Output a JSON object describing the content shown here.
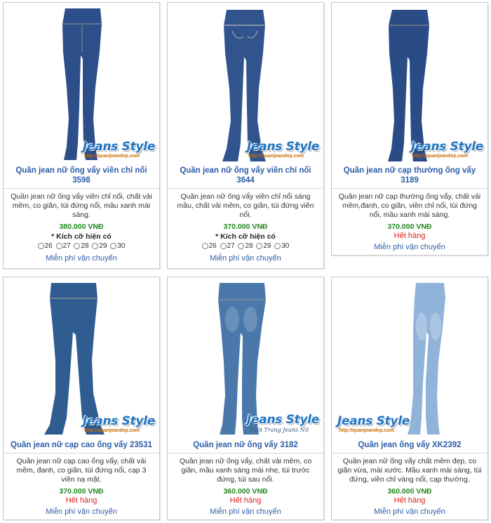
{
  "products": [
    {
      "title": "Quần jean nữ ống vẩy viền chỉ nổi 3598",
      "description": "Quần jean nữ ống vẩy viền chỉ nổi, chất vải mềm, co giãn, túi đứng nổi, mầu xanh mài sáng.",
      "price": "380.000 VNĐ",
      "status": "",
      "sizes_title": "* Kích cỡ hiện có",
      "sizes": [
        "26",
        "27",
        "28",
        "29",
        "30"
      ],
      "shipping": "Miễn phí vận chuyển",
      "jeans_color": "#2c4f8a",
      "watermark": "Jeans Style",
      "watermark_url": "http://quanjeandep.com"
    },
    {
      "title": "Quần jean nữ ống vẩy viền chỉ nổi 3644",
      "description": "Quần jean nữ ống vẩy viền chỉ nổi sáng mầu, chất vải mềm, co giãn, túi đứng viền nổi.",
      "price": "370.000 VNĐ",
      "status": "",
      "sizes_title": "* Kích cỡ hiện có",
      "sizes": [
        "26",
        "27",
        "28",
        "29",
        "30"
      ],
      "shipping": "Miễn phí vận chuyển",
      "jeans_color": "#31548e",
      "watermark": "Jeans Style",
      "watermark_url": "http://quanjeandep.com"
    },
    {
      "title": "Quần jean nữ cạp thường ống vẩy 3189",
      "description": "Quần jean nữ cạp thường ống vẩy, chất vải mềm,đanh, co giãn, viền chỉ nổi, túi đứng nổi, mầu xanh mài sáng.",
      "price": "370.000 VNĐ",
      "status": "Hết hàng",
      "sizes_title": "",
      "sizes": [],
      "shipping": "Miễn phí vận chuyển",
      "jeans_color": "#2a4c86",
      "watermark": "Jeans Style",
      "watermark_url": "http://quanjeandep.com"
    },
    {
      "title": "Quần jean nữ cạp cao ống vẩy 23531",
      "description": "Quần jean nữ cạp cao ống vẩy, chất vải mềm, đanh, co giãn, túi đứng nổi, cạp 3 viền nạ mặt.",
      "price": "370.000 VNĐ",
      "status": "Hết hàng",
      "sizes_title": "",
      "sizes": [],
      "shipping": "Miễn phí vận chuyển",
      "jeans_color": "#2f5d91",
      "watermark": "Jeans Style",
      "watermark_url": "http://quanjeandep.com"
    },
    {
      "title": "Quần jean nữ ống vẩy 3182",
      "description": "Quần jean nữ ống vẩy, chất vải mềm, co giãn, mầu xanh sáng mài nhẹ, túi trước đứng, túi sau nổi.",
      "price": "360.000 VNĐ",
      "status": "Hết hàng",
      "sizes_title": "",
      "sizes": [],
      "shipping": "Miễn phí vận chuyển",
      "jeans_color": "#4a78aa",
      "watermark": "Jeans Style",
      "watermark_url": "Thời Trang Jeans Nữ"
    },
    {
      "title": "Quần jean ống vẩy XK2392",
      "description": "Quần jean nữ ống vẩy chất mềm đẹp, co giãn vừa, mài xước. Mầu xanh mài sáng, túi đứng, viền chỉ vàng nổi, cạp thường.",
      "price": "360.000 VNĐ",
      "status": "Hết hàng",
      "sizes_title": "",
      "sizes": [],
      "shipping": "Miễn phí vận chuyển",
      "jeans_color": "#8fb3d9",
      "watermark": "Jeans Style",
      "watermark_url": "http://quanjeandep.com"
    }
  ]
}
